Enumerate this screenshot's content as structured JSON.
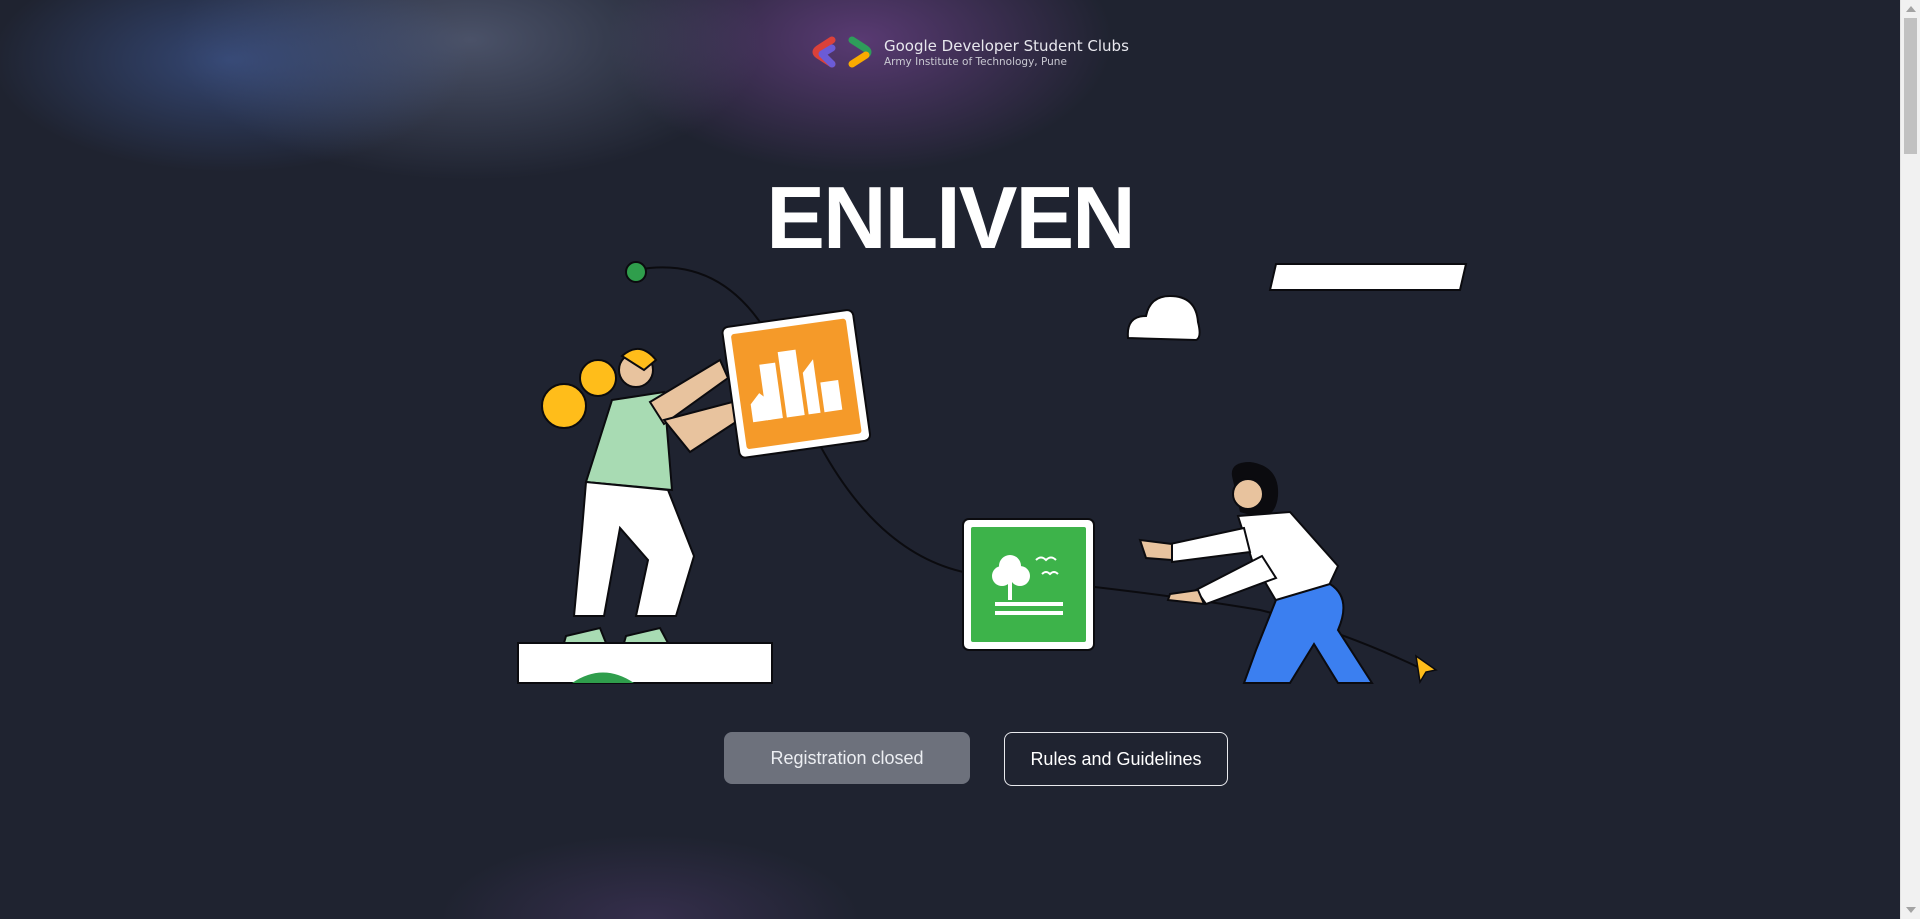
{
  "brand": {
    "title": "Google Developer Student Clubs",
    "subtitle": "Army Institute of Technology, Pune",
    "logo_icon": "gdsc-logo-icon"
  },
  "hero": {
    "title": "ENLIVEN"
  },
  "illustration": {
    "description_icons": [
      "city-card-icon",
      "nature-card-icon",
      "person-holding-card",
      "person-pulling-rope",
      "cursor-arrow-icon",
      "cloud-icon"
    ]
  },
  "actions": {
    "registration_label": "Registration closed",
    "rules_label": "Rules and Guidelines"
  },
  "colors": {
    "background": "#1f2330",
    "orange": "#f59a29",
    "green": "#3db34a",
    "blue": "#3b7ff0",
    "yellow": "#ffbd1a"
  }
}
